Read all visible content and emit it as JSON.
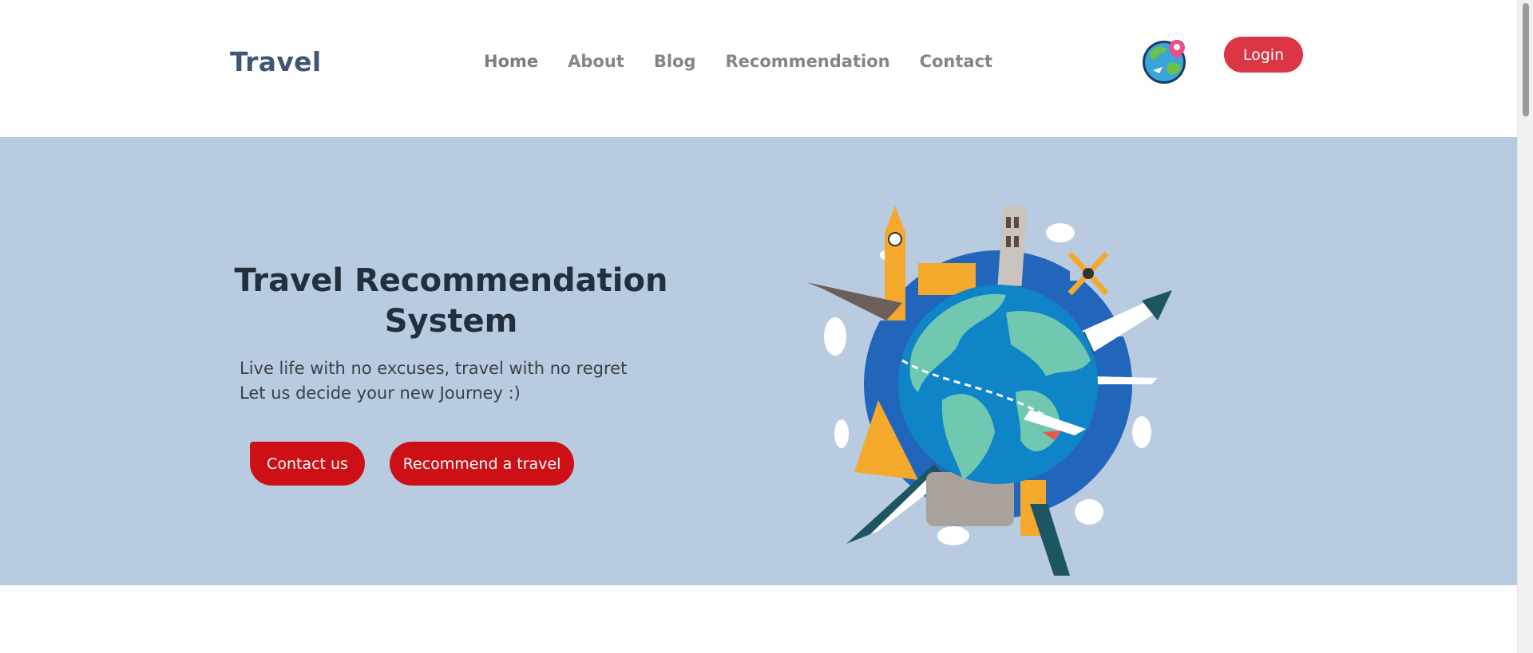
{
  "header": {
    "brand": "Travel",
    "nav": [
      "Home",
      "About",
      "Blog",
      "Recommendation",
      "Contact"
    ],
    "logo_icon": "globe-location-icon",
    "login_label": "Login"
  },
  "hero": {
    "title": "Travel Recommendation System",
    "subtitle_line1": "Live life with no excuses, travel with no regret",
    "subtitle_line2": "Let us decide your new Journey :)",
    "contact_label": "Contact us",
    "recommend_label": "Recommend a travel",
    "illustration_icon": "world-landmarks-globe-illustration"
  },
  "colors": {
    "brand_text": "#3f5672",
    "nav_text": "#858585",
    "login_bg": "#dc3545",
    "hero_bg": "#b8cbe0",
    "hero_title": "#232e3e",
    "hero_button_bg": "#cc1016"
  }
}
